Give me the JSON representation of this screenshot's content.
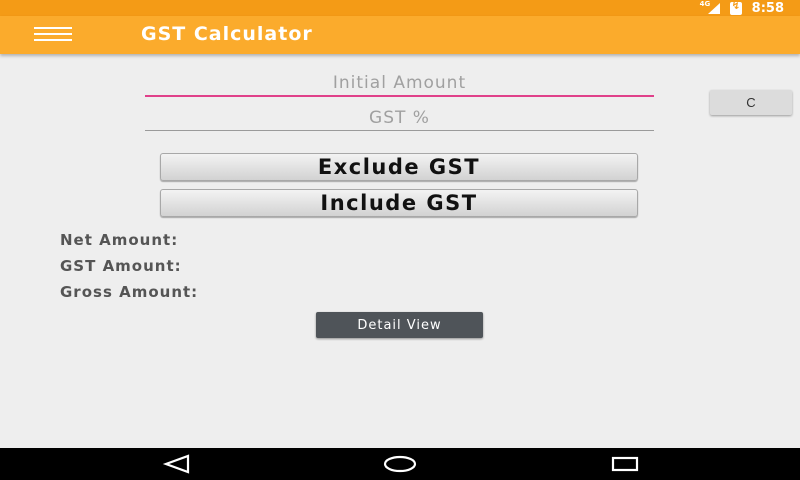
{
  "status_bar": {
    "network": "4G",
    "time": "8:58"
  },
  "app_bar": {
    "title": "GST Calculator"
  },
  "form": {
    "amount_placeholder": "Initial Amount",
    "amount_value": "",
    "gst_placeholder": "GST %",
    "gst_value": "",
    "clear_label": "C"
  },
  "actions": {
    "exclude_label": "Exclude GST",
    "include_label": "Include GST"
  },
  "results": {
    "net_label": "Net Amount:",
    "net_value": "",
    "gst_label": "GST Amount:",
    "gst_value": "",
    "gross_label": "Gross Amount:",
    "gross_value": ""
  },
  "detail_label": "Detail View",
  "colors": {
    "status_bar": "#f49b16",
    "app_bar": "#fbab2c",
    "accent": "#e0408a",
    "nav_bar": "#000000"
  },
  "icons": {
    "menu": "hamburger-menu-icon",
    "back": "back-icon",
    "home": "home-icon",
    "recents": "recents-icon"
  }
}
